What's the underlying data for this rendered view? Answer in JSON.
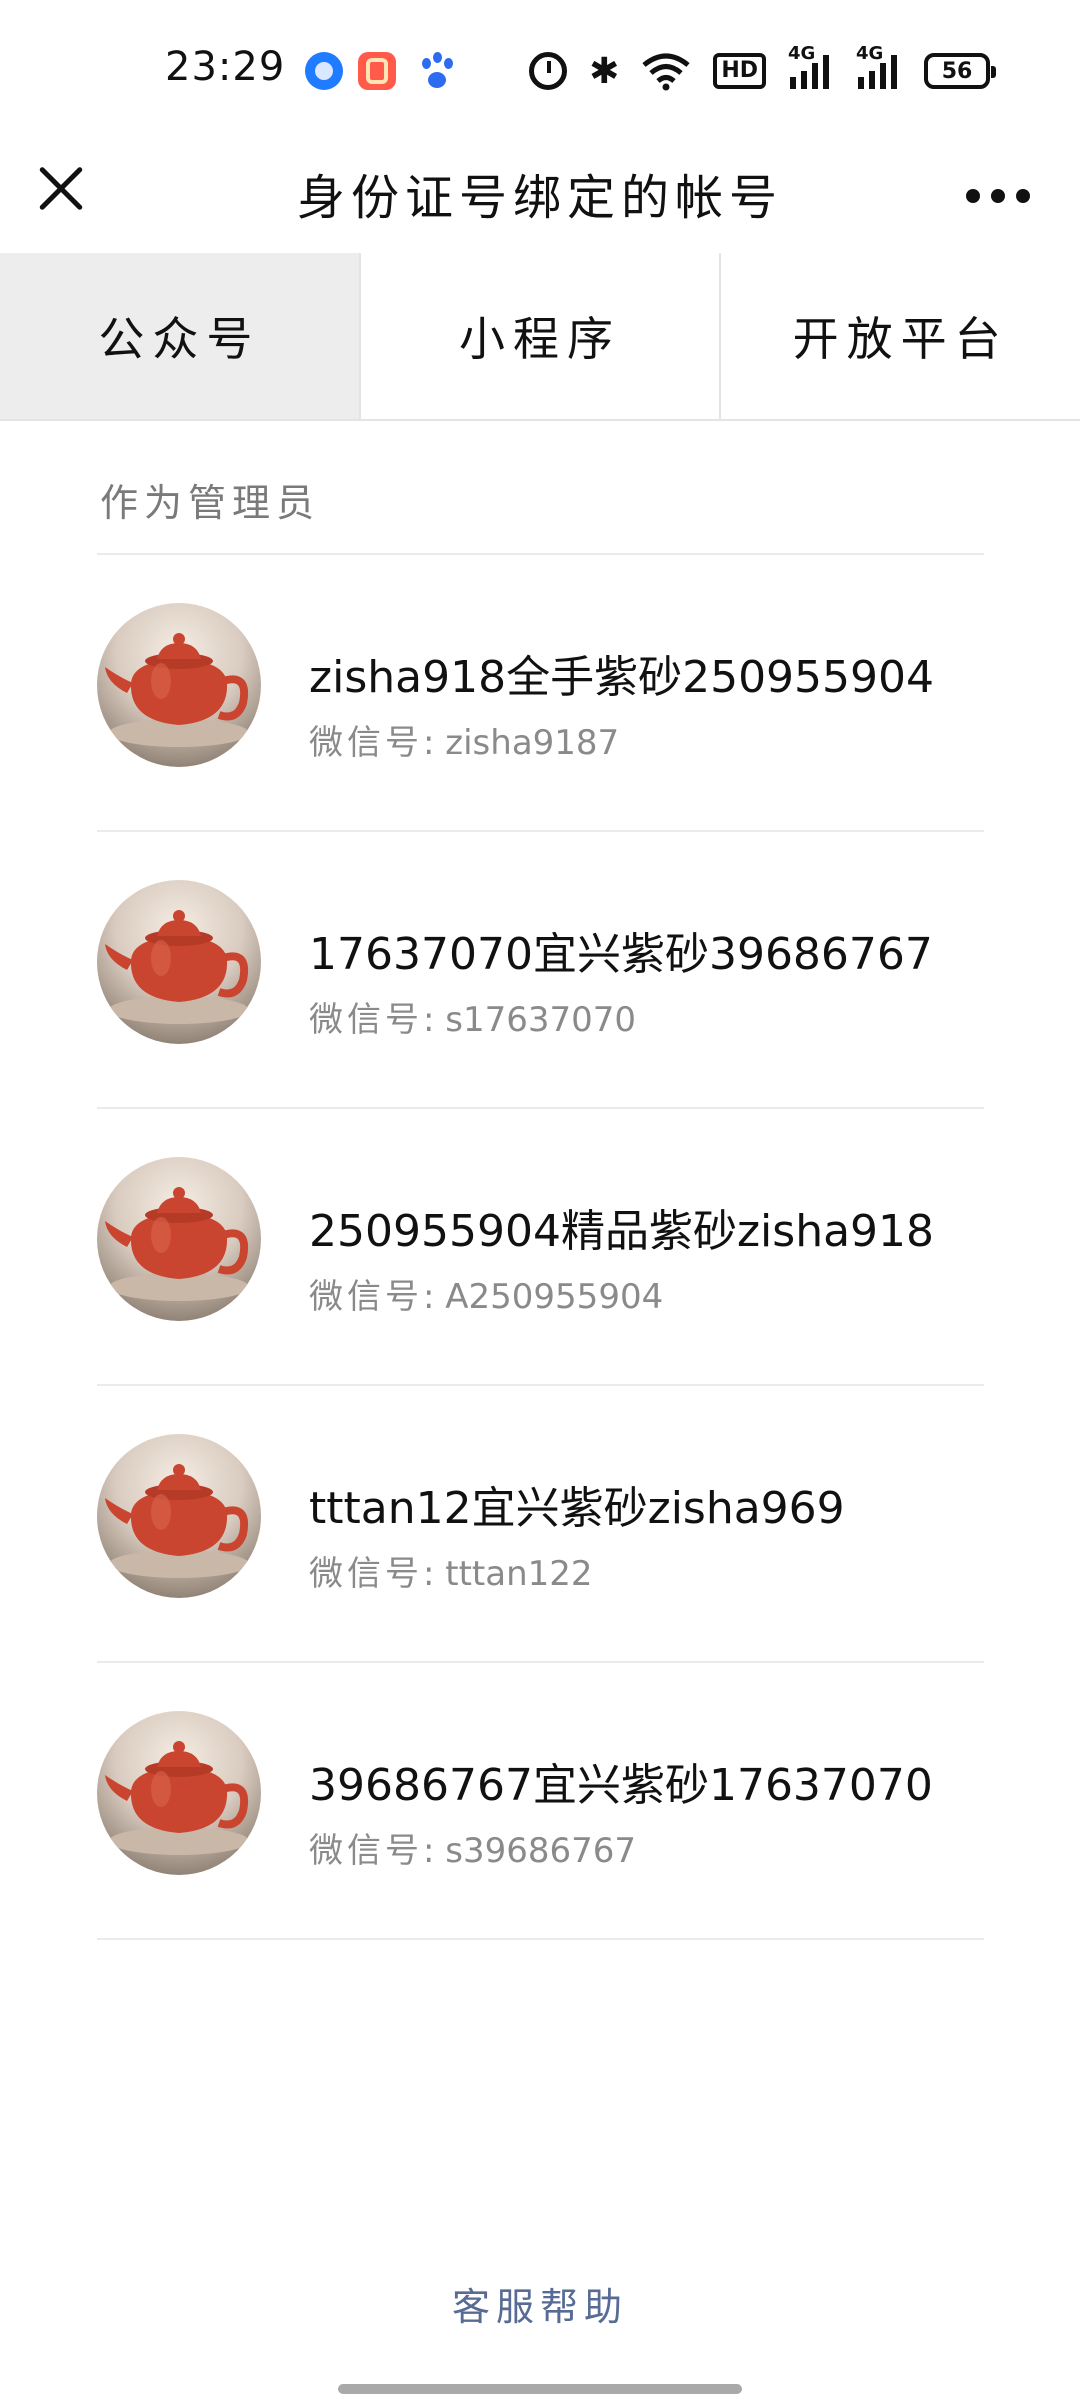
{
  "status_bar": {
    "time": "23:29",
    "network_label": "HD",
    "signal_1": "4G",
    "signal_2": "4G",
    "battery": "56",
    "icons": [
      "browser-app-icon",
      "kuaishou-app-icon",
      "baidu-app-icon",
      "alarm-icon",
      "bluetooth-icon",
      "wifi-icon",
      "hd-icon",
      "signal-icon",
      "signal-icon",
      "battery-icon"
    ]
  },
  "nav": {
    "title": "身份证号绑定的帐号",
    "close_icon": "close-icon",
    "more_icon": "more-icon"
  },
  "tabs": [
    {
      "label": "公众号",
      "active": true
    },
    {
      "label": "小程序",
      "active": false
    },
    {
      "label": "开放平台",
      "active": false
    }
  ],
  "section": {
    "label": "作为管理员"
  },
  "accounts": [
    {
      "name": "zisha918全手紫砂250955904",
      "id_prefix": "微信号",
      "id_value": ": zisha9187"
    },
    {
      "name": "17637070宜兴紫砂39686767",
      "id_prefix": "微信号",
      "id_value": ": s17637070"
    },
    {
      "name": "250955904精品紫砂zisha918",
      "id_prefix": "微信号",
      "id_value": ": A250955904"
    },
    {
      "name": "tttan12宜兴紫砂zisha969",
      "id_prefix": "微信号",
      "id_value": ": tttan122"
    },
    {
      "name": "39686767宜兴紫砂17637070",
      "id_prefix": "微信号",
      "id_value": ": s39686767"
    }
  ],
  "footer": {
    "help_label": "客服帮助"
  },
  "colors": {
    "link": "#576b95",
    "tab_active_bg": "#ededed",
    "divider": "#ebebeb",
    "teapot": "#c9452f"
  }
}
